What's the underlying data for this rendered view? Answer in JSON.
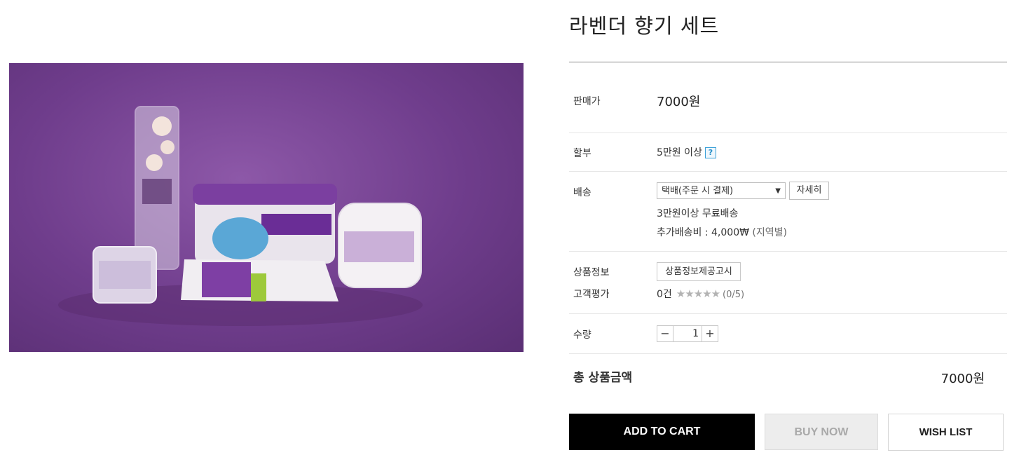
{
  "product": {
    "title": "라벤더 향기 세트",
    "image_alt": "lavender-product-photo"
  },
  "price": {
    "label": "판매가",
    "value": "7000원"
  },
  "installment": {
    "label": "할부",
    "value": "5만원 이상",
    "help_icon": "question-icon",
    "help_text": "?"
  },
  "shipping": {
    "label": "배송",
    "selected_option": "택배(주문 시 결제)",
    "detail_button": "자세히",
    "free_shipping": "3만원이상 무료배송",
    "extra_fee": "추가배송비 : 4,000₩",
    "extra_fee_note": "(지역별)"
  },
  "product_info": {
    "label": "상품정보",
    "notice_button": "상품정보제공고시"
  },
  "reviews": {
    "label": "고객평가",
    "count": "0건",
    "stars": "★★★★★",
    "score": "(0/5)"
  },
  "quantity": {
    "label": "수량",
    "minus": "−",
    "value": "1",
    "plus": "+"
  },
  "total": {
    "label": "총 상품금액",
    "value": "7000원"
  },
  "actions": {
    "add_to_cart": "ADD TO CART",
    "buy_now": "BUY NOW",
    "wish_list": "WISH LIST"
  },
  "colors": {
    "accent_purple": "#6f3d8c",
    "cart_button": "#000000",
    "buy_disabled": "#ededed"
  }
}
